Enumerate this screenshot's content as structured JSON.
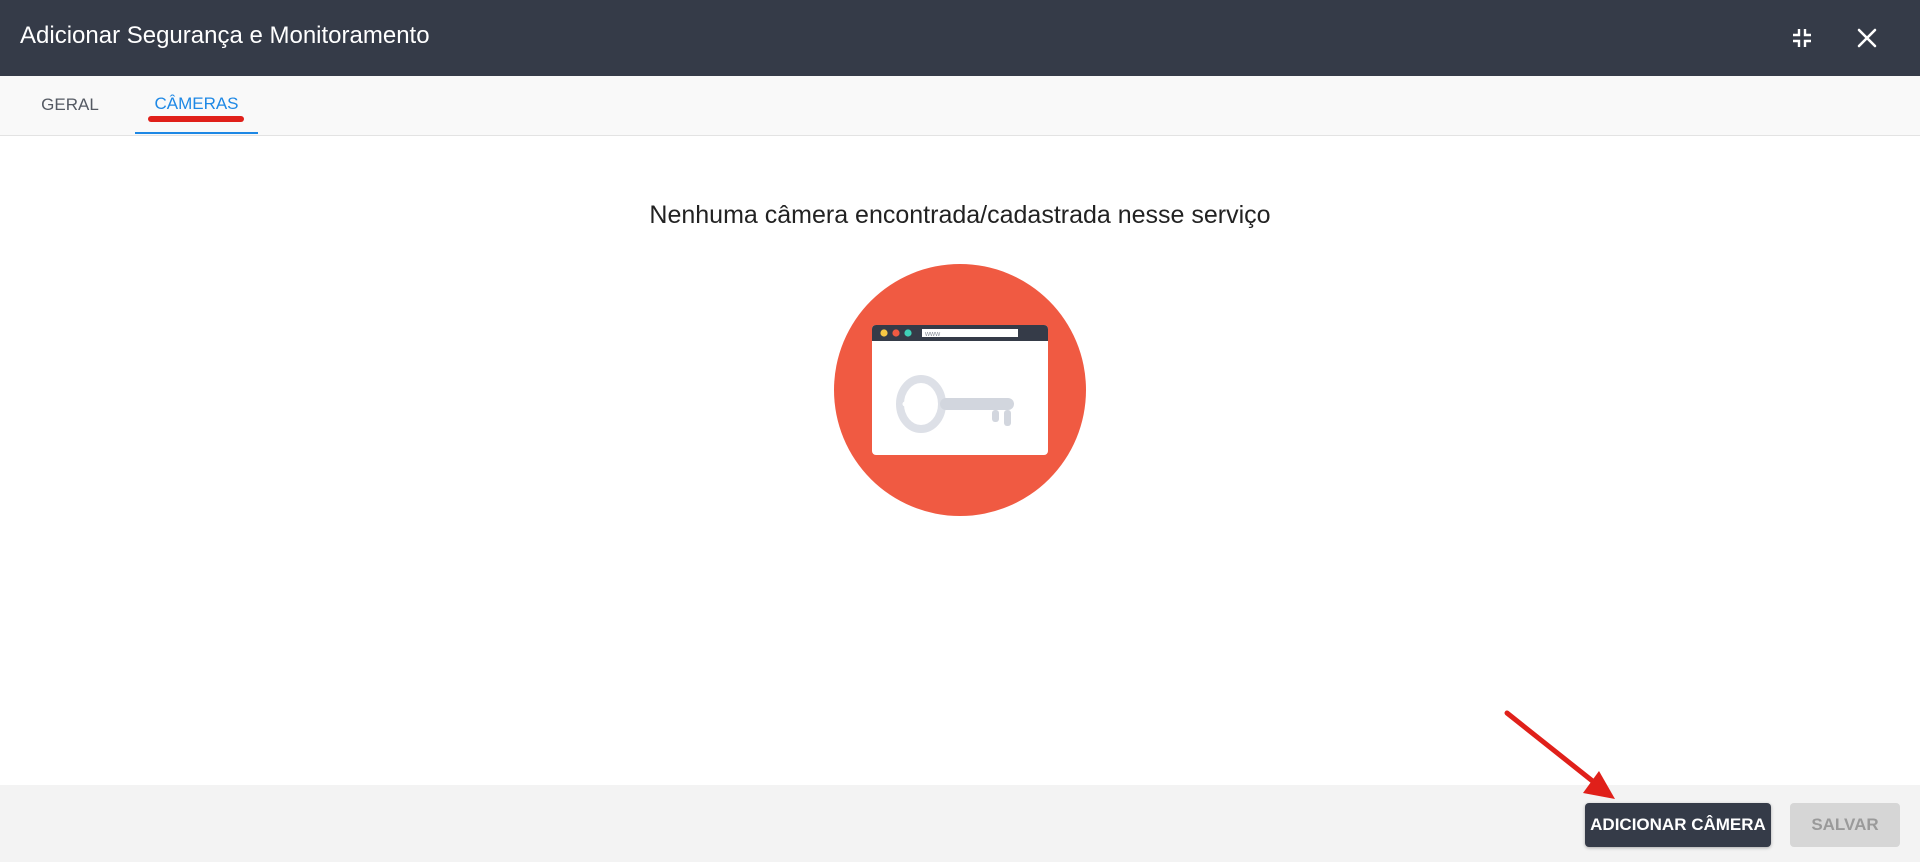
{
  "dialog": {
    "title": "Adicionar Segurança e Monitoramento",
    "minimize_icon": "minimize-icon",
    "close_icon": "close-icon"
  },
  "tabs": [
    {
      "label": "GERAL",
      "active": false
    },
    {
      "label": "CÂMERAS",
      "active": true
    }
  ],
  "content": {
    "empty_message": "Nenhuma câmera encontrada/cadastrada nesse serviço",
    "illustration": "browser-key-illustration",
    "illustration_url_text": "www"
  },
  "footer": {
    "add_camera_label": "ADICIONAR CÂMERA",
    "save_label": "SALVAR"
  },
  "colors": {
    "titlebar": "#353b48",
    "accent": "#1e88e5",
    "illustration_circle": "#f05a42",
    "annotation": "#e0201a"
  }
}
